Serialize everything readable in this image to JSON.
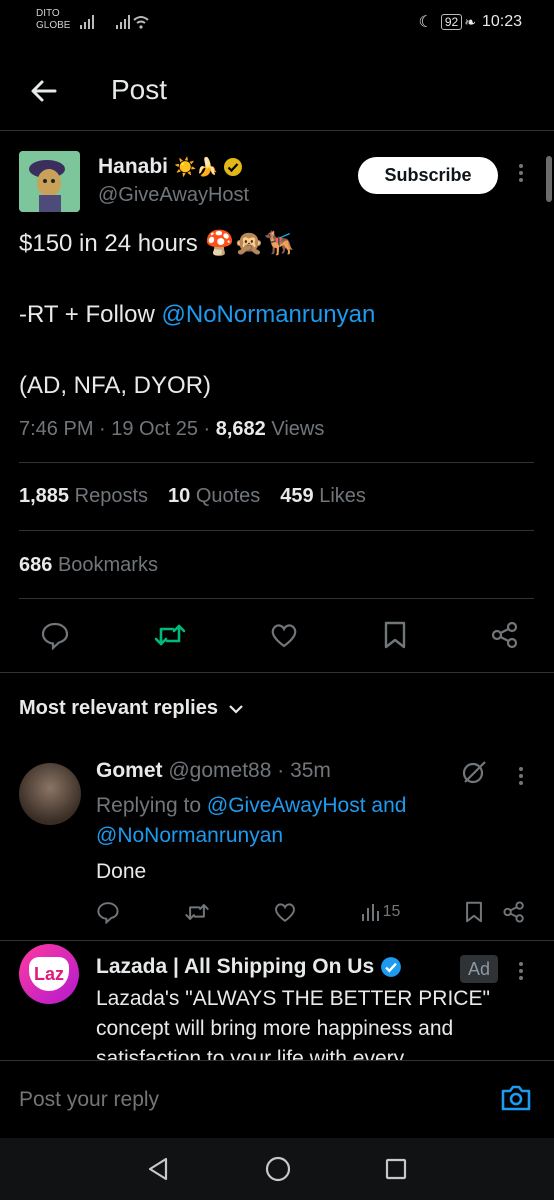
{
  "status_bar": {
    "carrier_line1": "DITO",
    "carrier_line2": "GLOBE",
    "battery": "92",
    "time": "10:23"
  },
  "header": {
    "title": "Post"
  },
  "tweet": {
    "display_name": "Hanabi",
    "name_emoji": "☀️🍌",
    "handle": "@GiveAwayHost",
    "subscribe_label": "Subscribe",
    "line1": "$150 in 24 hours 🍄🙊🐕‍🦺",
    "line2_prefix": "-RT + Follow ",
    "line2_mention": "@NoNormanrunyan",
    "line3": "(AD, NFA, DYOR)",
    "timestamp": "7:46 PM · 19 Oct 25 · ",
    "views_count": "8,682",
    "views_label": " Views",
    "reposts_count": "1,885",
    "reposts_label": "Reposts",
    "quotes_count": "10",
    "quotes_label": "Quotes",
    "likes_count": "459",
    "likes_label": "Likes",
    "bookmarks_count": "686",
    "bookmarks_label": "Bookmarks"
  },
  "replies_header": "Most relevant replies",
  "reply": {
    "name": "Gomet",
    "handle_time": "@gomet88 · 35m",
    "replying_prefix": "Replying to ",
    "replying_mention1": "@GiveAwayHost",
    "replying_and": " and",
    "replying_mention2": "@NoNormanrunyan",
    "text": "Done",
    "views": "15"
  },
  "ad": {
    "logo_text": "Laz",
    "name": "Lazada | All Shipping On Us",
    "badge": "Ad",
    "line1": "Lazada's \"ALWAYS THE BETTER PRICE\"",
    "line2": "concept will bring more happiness and",
    "line3": "satisfaction to your life with every"
  },
  "composer": {
    "placeholder": "Post your reply"
  },
  "colors": {
    "accent": "#1d9bf0",
    "repost_green": "#00ba7c",
    "verified_gold": "#e2b719"
  }
}
